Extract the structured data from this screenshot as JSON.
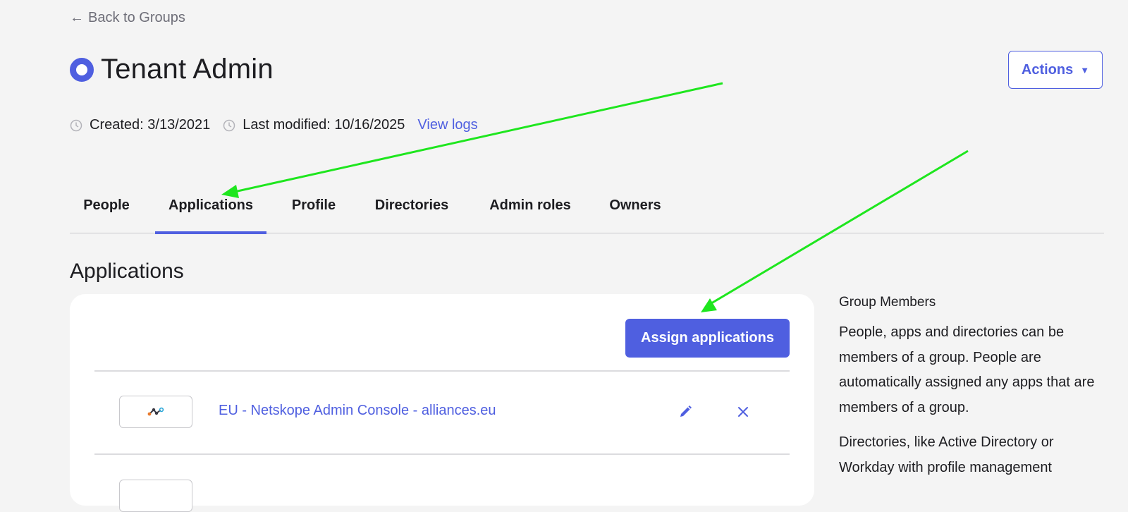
{
  "nav": {
    "back_arrow": "←",
    "back_label": "Back to Groups"
  },
  "header": {
    "group_icon": "group-ring-icon",
    "title": "Tenant Admin",
    "actions_label": "Actions",
    "actions_caret": "▼"
  },
  "meta": {
    "created": "Created: 3/13/2021",
    "modified": "Last modified: 10/16/2025",
    "view_logs": "View logs"
  },
  "tabs": [
    {
      "label": "People"
    },
    {
      "label": "Applications",
      "active": true
    },
    {
      "label": "Profile"
    },
    {
      "label": "Directories"
    },
    {
      "label": "Admin roles"
    },
    {
      "label": "Owners"
    }
  ],
  "main": {
    "section_title": "Applications",
    "assign_label": "Assign applications",
    "apps": [
      {
        "name": "EU - Netskope Admin Console - alliances.eu",
        "logo": "netskope-logo-icon"
      }
    ]
  },
  "sidebar": {
    "title": "Group Members",
    "paragraph1": "People, apps and directories can be members of a group. People are automatically assigned any apps that are members of a group.",
    "paragraph2": "Directories, like Active Directory or Workday with profile management"
  },
  "colors": {
    "accent": "#4f5fe0",
    "background": "#f4f4f4",
    "annotation_arrow": "#1ee61e"
  }
}
